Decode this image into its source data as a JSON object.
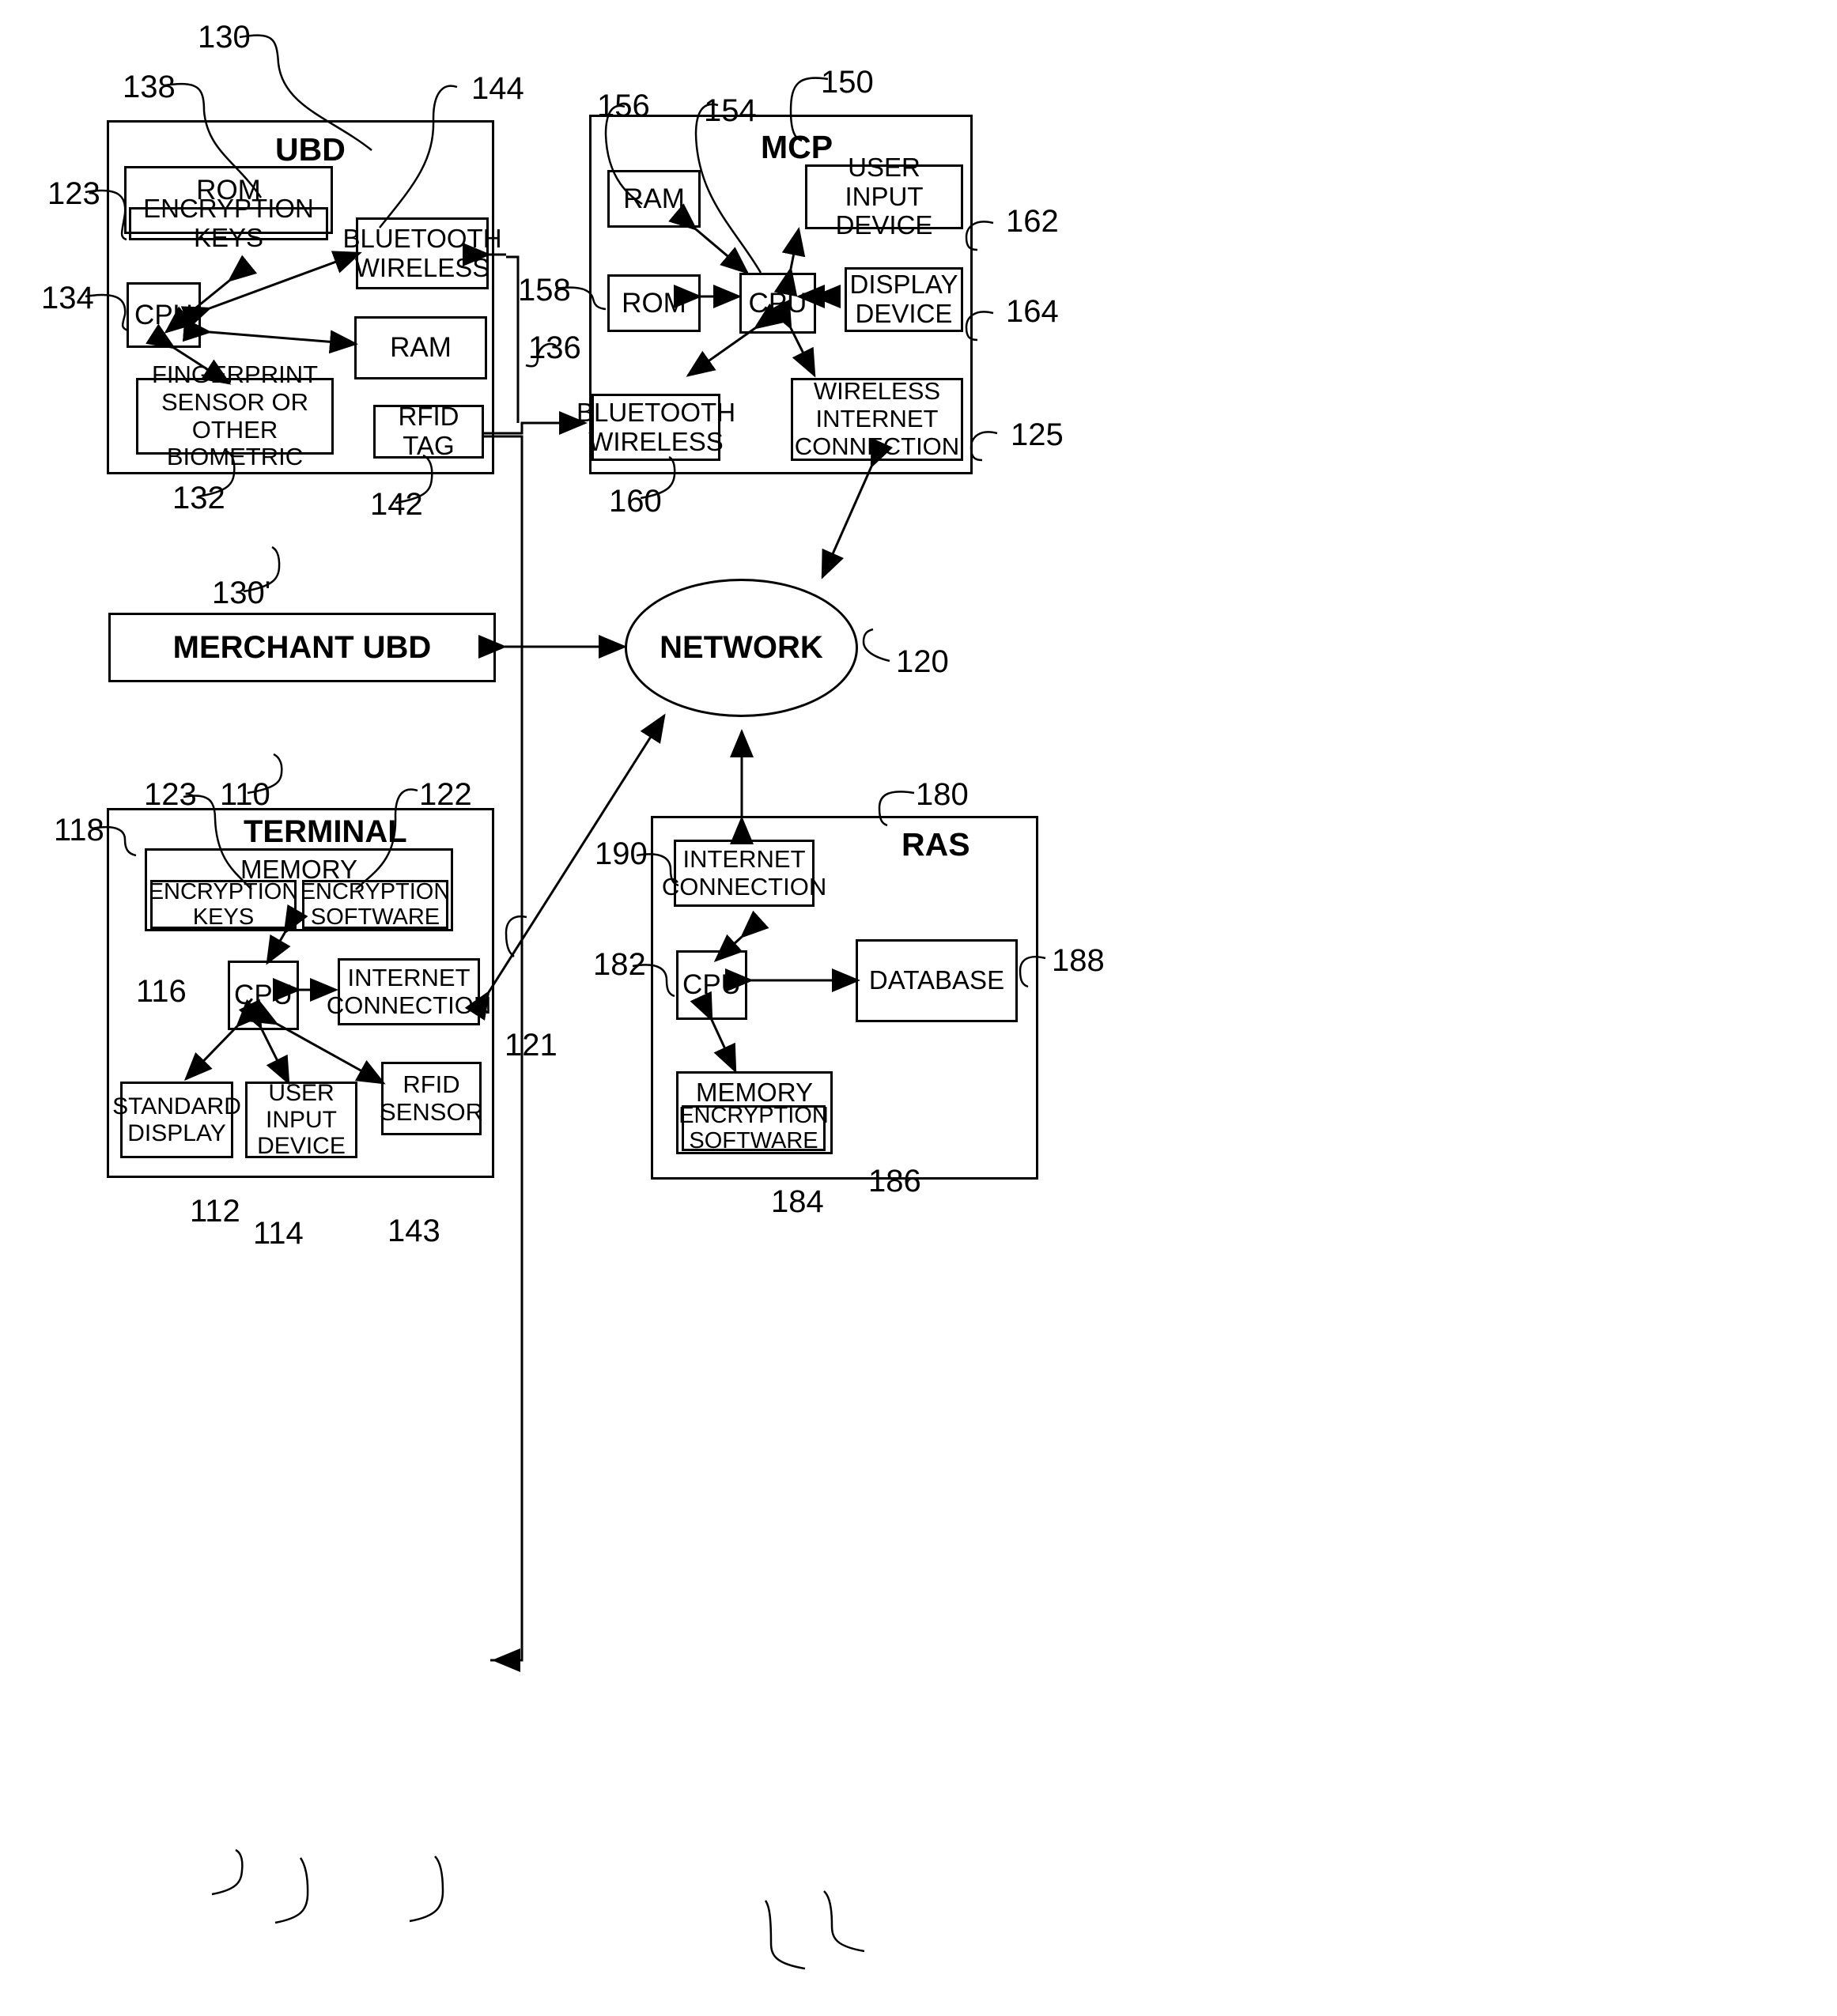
{
  "figure": {
    "ubd": {
      "title": "UBD",
      "ref": "130",
      "rom": {
        "label": "ROM",
        "ref": "138"
      },
      "encryption_keys": {
        "label": "ENCRYPTION KEYS",
        "ref": "123"
      },
      "cpu": {
        "label": "CPU",
        "ref": "134"
      },
      "bluetooth": {
        "label": "BLUETOOTH\nWIRELESS",
        "ref": "144"
      },
      "ram": {
        "label": "RAM",
        "ref": "136"
      },
      "biometric": {
        "label": "FINGERPRINT\nSENSOR OR\nOTHER BIOMETRIC",
        "ref": "132"
      },
      "rfid_tag": {
        "label": "RFID\nTAG",
        "ref": "142"
      }
    },
    "mcp": {
      "title": "MCP",
      "ref": "150",
      "ram": {
        "label": "RAM",
        "ref": "156"
      },
      "rom": {
        "label": "ROM",
        "ref": "158"
      },
      "cpu": {
        "label": "CPU",
        "ref": "154"
      },
      "user_input": {
        "label": "USER INPUT\nDEVICE",
        "ref": "162"
      },
      "display": {
        "label": "DISPLAY\nDEVICE",
        "ref": "164"
      },
      "bluetooth": {
        "label": "BLUETOOTH\nWIRELESS",
        "ref": "160"
      },
      "wireless_internet": {
        "label": "WIRELESS\nINTERNET\nCONNECTION",
        "ref": "125"
      }
    },
    "merchant_ubd": {
      "label": "MERCHANT UBD",
      "ref": "130'"
    },
    "network": {
      "label": "NETWORK",
      "ref": "120"
    },
    "terminal": {
      "title": "TERMINAL",
      "ref": "110",
      "memory": {
        "label": "MEMORY",
        "ref": "118"
      },
      "encryption_keys": {
        "label": "ENCRYPTION\nKEYS",
        "ref": "123"
      },
      "encryption_software": {
        "label": "ENCRYPTION\nSOFTWARE",
        "ref": "122"
      },
      "cpu": {
        "label": "CPU",
        "ref": "116"
      },
      "internet_connection": {
        "label": "INTERNET\nCONNECTION",
        "ref": "121"
      },
      "standard_display": {
        "label": "STANDARD\nDISPLAY",
        "ref": "112"
      },
      "user_input": {
        "label": "USER\nINPUT\nDEVICE",
        "ref": "114"
      },
      "rfid_sensor": {
        "label": "RFID\nSENSOR",
        "ref": "143"
      }
    },
    "ras": {
      "title": "RAS",
      "ref": "180",
      "internet_connection": {
        "label": "INTERNET\nCONNECTION",
        "ref": "190"
      },
      "cpu": {
        "label": "CPU",
        "ref": "182"
      },
      "database": {
        "label": "DATABASE",
        "ref": "188"
      },
      "memory": {
        "label": "MEMORY",
        "ref": "184"
      },
      "encryption_software": {
        "label": "ENCRYPTION\nSOFTWARE",
        "ref": "186"
      }
    }
  },
  "colors": {
    "stroke": "#000000",
    "background": "#ffffff"
  }
}
